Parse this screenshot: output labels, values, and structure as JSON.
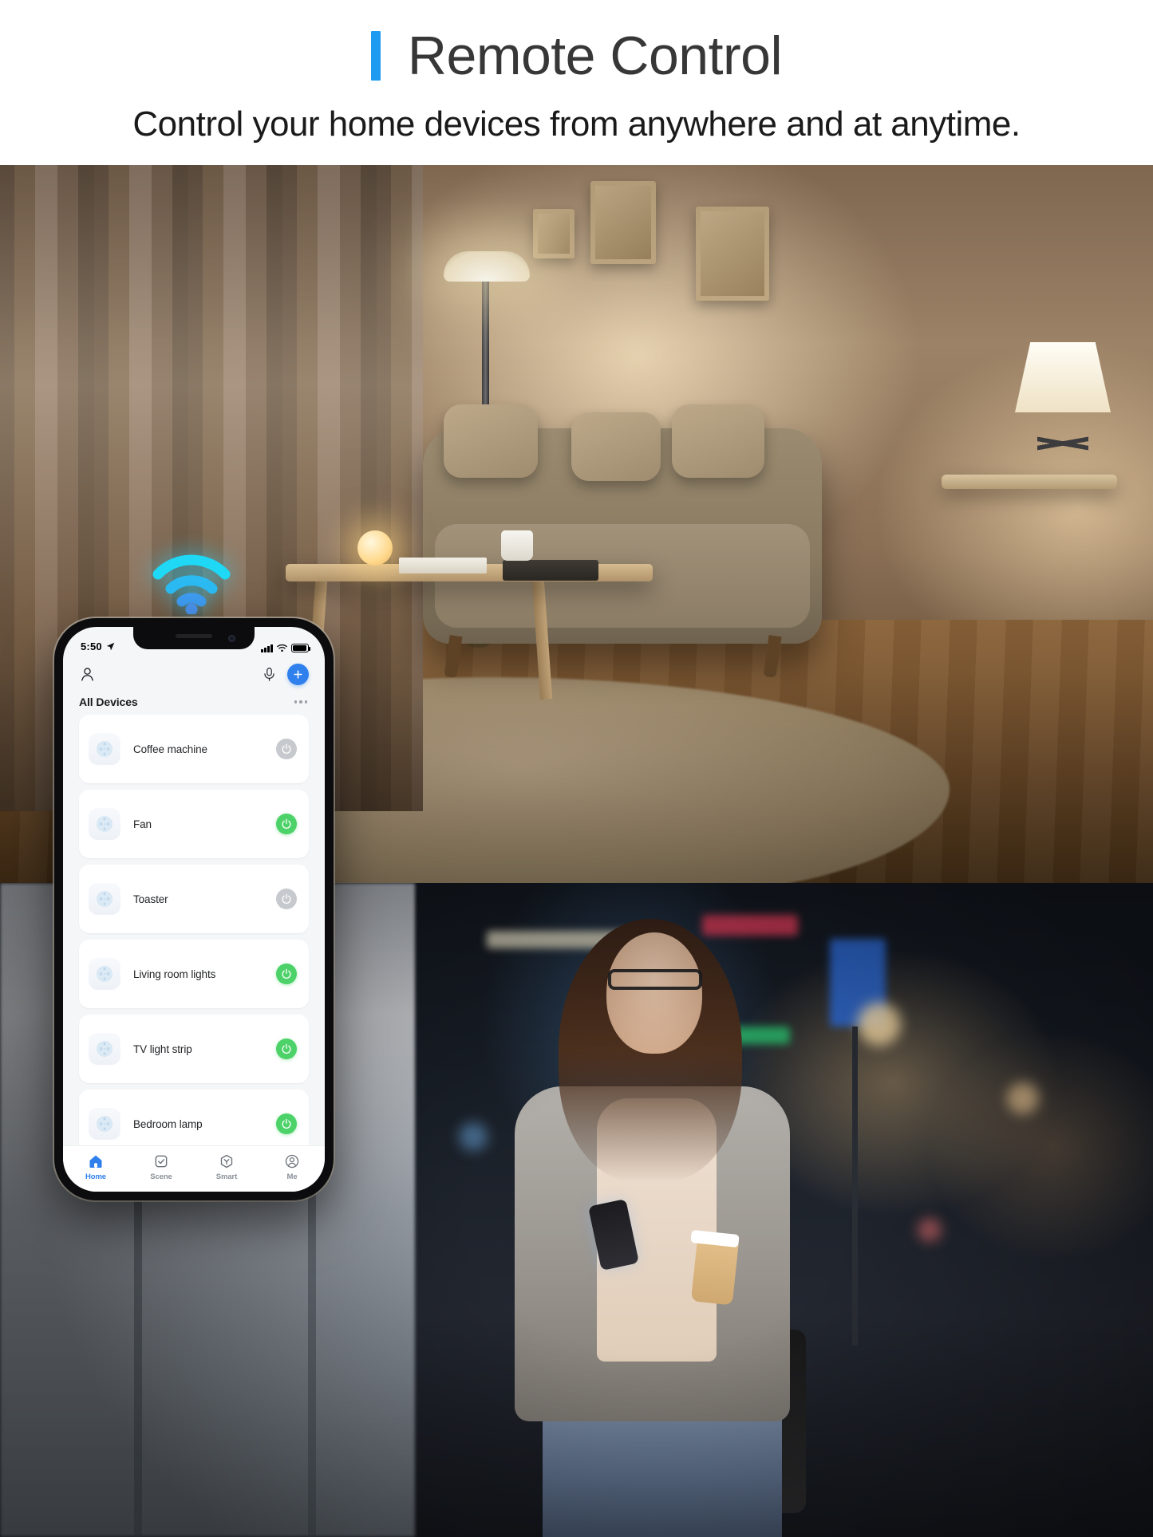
{
  "header": {
    "title": "Remote Control",
    "subtitle": "Control your home devices from anywhere and at anytime.",
    "accent_color": "#1E9BF0"
  },
  "hero": {
    "scene_description": "Warm-lit living room at night with sofa, floor lamp, table lamp and coffee table",
    "wifi_icon": "wifi-signal-icon",
    "wifi_color": "#2ACFF5"
  },
  "bottom_scene": {
    "scene_description": "Woman walking on a city street at night holding a smartphone and a coffee cup"
  },
  "phone": {
    "status_bar": {
      "time": "5:50",
      "location_icon": "location-arrow-icon",
      "signal_icon": "cellular-signal-icon",
      "wifi_icon": "wifi-icon",
      "battery_icon": "battery-full-icon"
    },
    "app_header": {
      "profile_icon": "person-icon",
      "voice_icon": "microphone-icon",
      "add_label": "+",
      "add_icon": "plus-icon",
      "section_title": "All Devices",
      "more_icon": "more-horizontal-icon"
    },
    "devices": [
      {
        "name": "Coffee machine",
        "icon": "smart-plug-icon",
        "power": "off"
      },
      {
        "name": "Fan",
        "icon": "smart-plug-icon",
        "power": "on"
      },
      {
        "name": "Toaster",
        "icon": "smart-plug-icon",
        "power": "off"
      },
      {
        "name": "Living room lights",
        "icon": "smart-plug-icon",
        "power": "on"
      },
      {
        "name": "TV light strip",
        "icon": "smart-plug-icon",
        "power": "on"
      },
      {
        "name": "Bedroom lamp",
        "icon": "smart-plug-icon",
        "power": "on"
      }
    ],
    "tabs": [
      {
        "label": "Home",
        "icon": "home-icon",
        "active": true
      },
      {
        "label": "Scene",
        "icon": "check-square-icon",
        "active": false
      },
      {
        "label": "Smart",
        "icon": "hexagon-y-icon",
        "active": false
      },
      {
        "label": "Me",
        "icon": "account-circle-icon",
        "active": false
      }
    ],
    "colors": {
      "accent": "#2F80ED",
      "power_on": "#4CD268",
      "power_off": "#C6C9CD",
      "screen_bg": "#F5F6F8"
    }
  }
}
